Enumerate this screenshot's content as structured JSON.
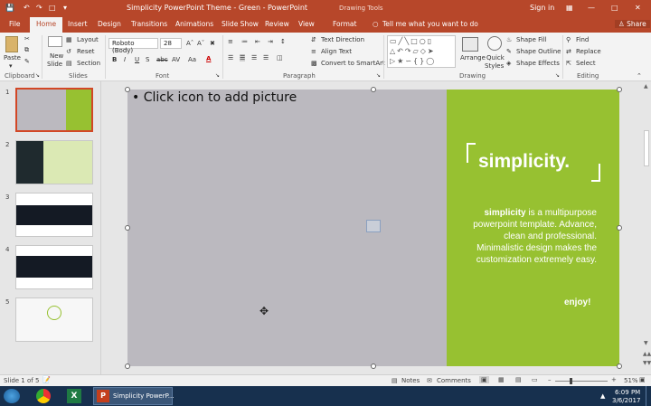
{
  "window": {
    "title": "Simplicity PowerPoint Theme - Green  -  PowerPoint",
    "context_tools": "Drawing Tools",
    "sign_in": "Sign in"
  },
  "tabs": {
    "file": "File",
    "home": "Home",
    "insert": "Insert",
    "design": "Design",
    "transitions": "Transitions",
    "animations": "Animations",
    "slideshow": "Slide Show",
    "review": "Review",
    "view": "View",
    "format": "Format",
    "tell_me": "Tell me what you want to do",
    "share": "Share"
  },
  "ribbon": {
    "clipboard": {
      "paste": "Paste",
      "label": "Clipboard"
    },
    "slides": {
      "new_slide": "New",
      "new_slide2": "Slide",
      "layout": "Layout",
      "reset": "Reset",
      "section": "Section",
      "label": "Slides"
    },
    "font": {
      "family": "Roboto (Body)",
      "size": "28",
      "label": "Font",
      "bold": "B",
      "italic": "I",
      "underline": "U",
      "strike": "S",
      "shadow": "abc",
      "spacing": "AV",
      "case": "Aa",
      "color": "A"
    },
    "paragraph": {
      "text_direction": "Text Direction",
      "align_text": "Align Text",
      "smartart": "Convert to SmartArt",
      "label": "Paragraph"
    },
    "drawing": {
      "arrange": "Arrange",
      "quick_styles": "Quick",
      "quick_styles2": "Styles",
      "shape_fill": "Shape Fill",
      "shape_outline": "Shape Outline",
      "shape_effects": "Shape Effects",
      "label": "Drawing"
    },
    "editing": {
      "find": "Find",
      "replace": "Replace",
      "select": "Select",
      "label": "Editing"
    }
  },
  "slides": [
    {
      "num": "1"
    },
    {
      "num": "2"
    },
    {
      "num": "3"
    },
    {
      "num": "4"
    },
    {
      "num": "5"
    }
  ],
  "slide": {
    "placeholder": "Click icon to add picture",
    "brand": "simplicity.",
    "body_lead": "simplicity",
    "body_rest": " is a multipurpose powerpoint template. Advance, clean and professional. Minimalistic design makes the customization extremely easy.",
    "enjoy": "enjoy!"
  },
  "status": {
    "slide_of": "Slide 1 of 5",
    "notes": "Notes",
    "comments": "Comments",
    "zoom": "51%"
  },
  "taskbar": {
    "app": "Simplicity PowerP...",
    "time": "6:09 PM",
    "date": "3/6/2017"
  },
  "colors": {
    "accent": "#b7472a",
    "green": "#97c131",
    "placeholder": "#bbb9bf"
  }
}
